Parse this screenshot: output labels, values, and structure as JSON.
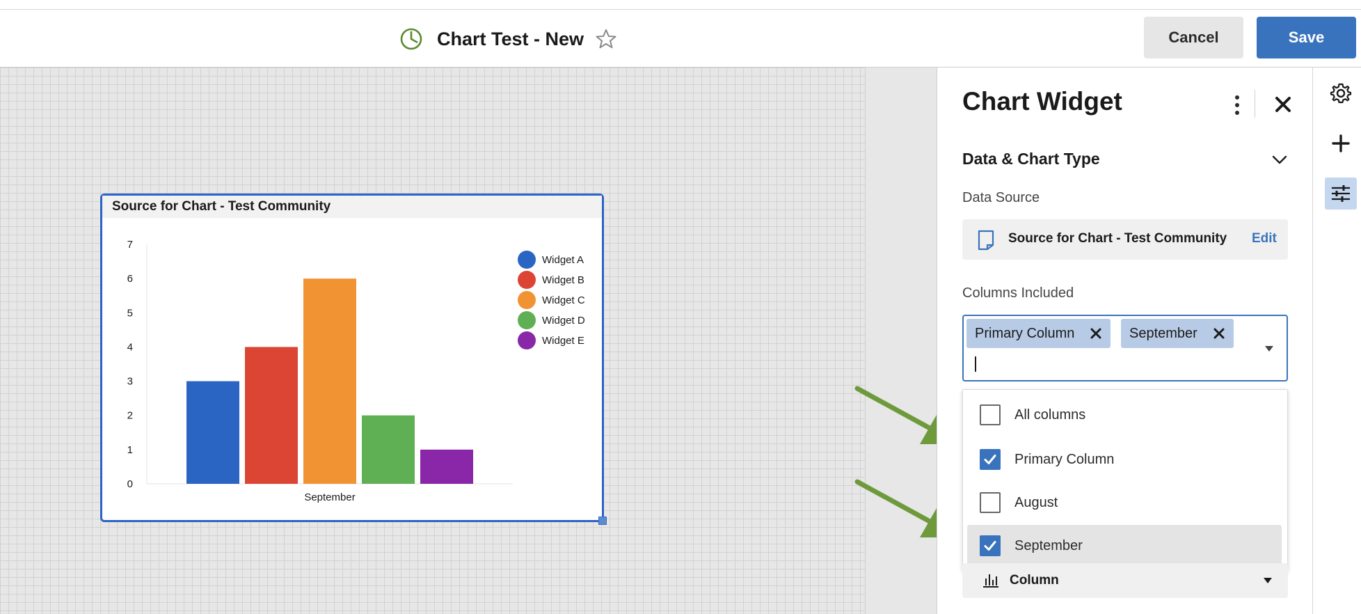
{
  "header": {
    "title": "Chart Test - New",
    "cancel_label": "Cancel",
    "save_label": "Save",
    "icons": [
      "pie-chart-icon",
      "star-outline-icon"
    ]
  },
  "widget": {
    "title": "Source for Chart - Test Community"
  },
  "chart_data": {
    "type": "bar",
    "categories": [
      "September"
    ],
    "series": [
      {
        "name": "Widget A",
        "values": [
          3
        ],
        "color": "#2b65c4"
      },
      {
        "name": "Widget B",
        "values": [
          4
        ],
        "color": "#dc4534"
      },
      {
        "name": "Widget C",
        "values": [
          6
        ],
        "color": "#f29333"
      },
      {
        "name": "Widget D",
        "values": [
          2
        ],
        "color": "#5faf55"
      },
      {
        "name": "Widget E",
        "values": [
          1
        ],
        "color": "#8a27a8"
      }
    ],
    "yticks": [
      0,
      1,
      2,
      3,
      4,
      5,
      6,
      7
    ],
    "ylim": [
      0,
      7
    ],
    "legend": "top-right"
  },
  "panel": {
    "title": "Chart Widget",
    "section_title": "Data & Chart Type",
    "data_source_label": "Data Source",
    "data_source_name": "Source for Chart - Test Community",
    "edit_label": "Edit",
    "columns_label": "Columns Included",
    "chips": [
      "Primary Column",
      "September"
    ],
    "menu_items": [
      {
        "label": "All columns",
        "checked": false
      },
      {
        "label": "Primary Column",
        "checked": true
      },
      {
        "label": "August",
        "checked": false
      },
      {
        "label": "September",
        "checked": true
      }
    ],
    "chart_type_label": "Column"
  },
  "rail": {
    "icons": [
      "gear-icon",
      "plus-icon",
      "sliders-icon"
    ],
    "active": "sliders-icon"
  },
  "colors": {
    "accent": "#3a73bd",
    "widget_border": "#2b63c6",
    "arrow": "#6e9a3c"
  }
}
